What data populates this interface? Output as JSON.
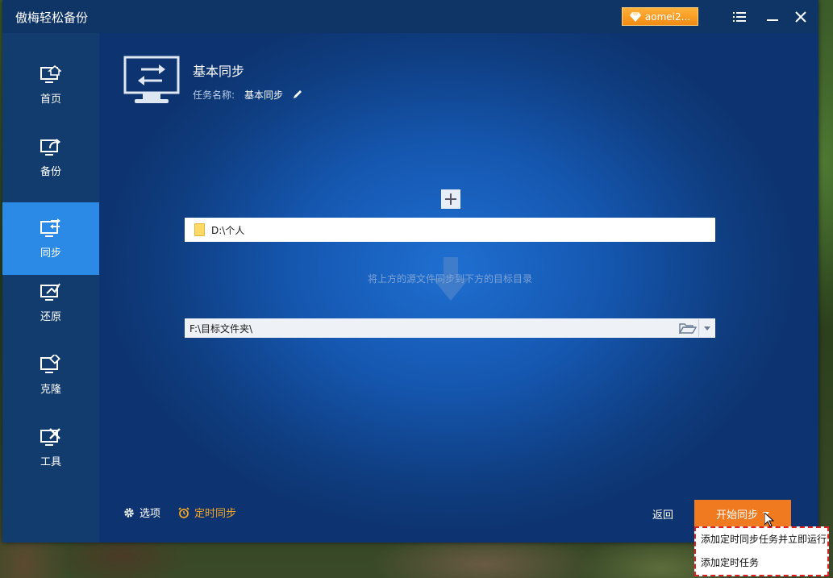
{
  "app": {
    "title": "傲梅轻松备份"
  },
  "titlebar": {
    "upgrade_label": "aomei2...",
    "icons": [
      "gem-icon",
      "menu-icon",
      "minimize-icon",
      "close-icon"
    ]
  },
  "sidebar": {
    "items": [
      {
        "label": "首页",
        "icon": "home-icon"
      },
      {
        "label": "备份",
        "icon": "backup-icon"
      },
      {
        "label": "同步",
        "icon": "sync-icon",
        "active": true
      },
      {
        "label": "还原",
        "icon": "restore-icon"
      },
      {
        "label": "克隆",
        "icon": "clone-icon"
      },
      {
        "label": "工具",
        "icon": "tools-icon"
      }
    ]
  },
  "page": {
    "title": "基本同步",
    "task_label": "任务名称:",
    "task_value": "基本同步"
  },
  "source": {
    "path": "D:\\个人"
  },
  "hint": "将上方的源文件同步到下方的目标目录",
  "destination": {
    "path": "F:\\目标文件夹\\"
  },
  "footer": {
    "options_label": "选项",
    "schedule_label": "定时同步",
    "back_label": "返回",
    "start_label": "开始同步"
  },
  "start_menu": {
    "items": [
      "添加定时同步任务并立即运行",
      "添加定时任务"
    ]
  },
  "colors": {
    "accent": "#2a8ae6",
    "start": "#f07a1f",
    "schedule": "#f5a623",
    "upgrade": "#f28b13"
  }
}
